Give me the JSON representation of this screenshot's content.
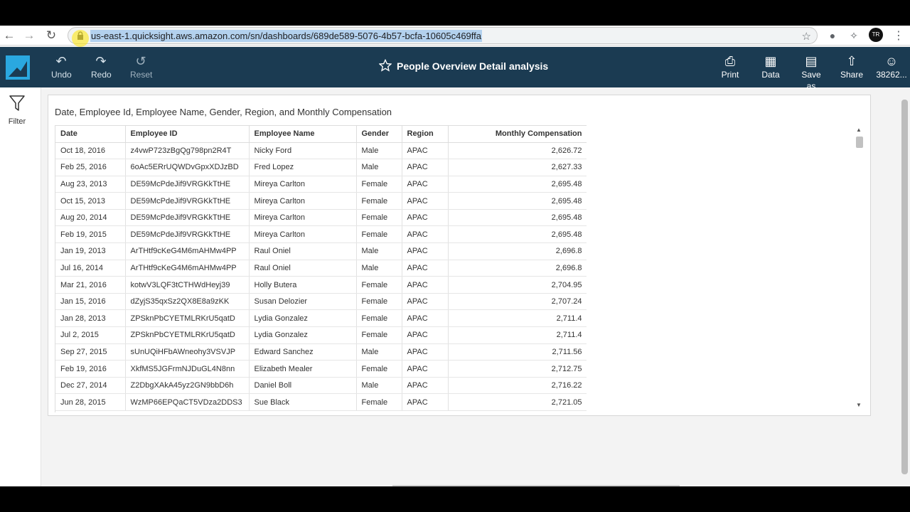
{
  "browser": {
    "url": "us-east-1.quicksight.aws.amazon.com/sn/dashboards/689de589-5076-4b57-bcfa-10605c469ffa",
    "profile_badge": "TR"
  },
  "toolbar": {
    "undo_label": "Undo",
    "redo_label": "Redo",
    "reset_label": "Reset",
    "title": "People Overview Detail analysis",
    "print_label": "Print",
    "data_label": "Data",
    "save_as_label": "Save as",
    "share_label": "Share",
    "account_label": "38262..."
  },
  "rail": {
    "filter_label": "Filter"
  },
  "visual": {
    "title": "Date, Employee Id, Employee Name, Gender, Region, and Monthly Compensation",
    "columns": [
      "Date",
      "Employee ID",
      "Employee Name",
      "Gender",
      "Region",
      "Monthly Compensation"
    ],
    "rows": [
      [
        "Oct 18, 2016",
        "z4vwP723zBgQg798pn2R4T",
        "Nicky Ford",
        "Male",
        "APAC",
        "2,626.72"
      ],
      [
        "Feb 25, 2016",
        "6oAc5ERrUQWDvGpxXDJzBD",
        "Fred Lopez",
        "Male",
        "APAC",
        "2,627.33"
      ],
      [
        "Aug 23, 2013",
        "DE59McPdeJif9VRGKkTtHE",
        "Mireya Carlton",
        "Female",
        "APAC",
        "2,695.48"
      ],
      [
        "Oct 15, 2013",
        "DE59McPdeJif9VRGKkTtHE",
        "Mireya Carlton",
        "Female",
        "APAC",
        "2,695.48"
      ],
      [
        "Aug 20, 2014",
        "DE59McPdeJif9VRGKkTtHE",
        "Mireya Carlton",
        "Female",
        "APAC",
        "2,695.48"
      ],
      [
        "Feb 19, 2015",
        "DE59McPdeJif9VRGKkTtHE",
        "Mireya Carlton",
        "Female",
        "APAC",
        "2,695.48"
      ],
      [
        "Jan 19, 2013",
        "ArTHtf9cKeG4M6mAHMw4PP",
        "Raul Oniel",
        "Male",
        "APAC",
        "2,696.8"
      ],
      [
        "Jul 16, 2014",
        "ArTHtf9cKeG4M6mAHMw4PP",
        "Raul Oniel",
        "Male",
        "APAC",
        "2,696.8"
      ],
      [
        "Mar 21, 2016",
        "kotwV3LQF3tCTHWdHeyj39",
        "Holly Butera",
        "Female",
        "APAC",
        "2,704.95"
      ],
      [
        "Jan 15, 2016",
        "dZyjS35qxSz2QX8E8a9zKK",
        "Susan Delozier",
        "Female",
        "APAC",
        "2,707.24"
      ],
      [
        "Jan 28, 2013",
        "ZPSknPbCYETMLRKrU5qatD",
        "Lydia Gonzalez",
        "Female",
        "APAC",
        "2,711.4"
      ],
      [
        "Jul 2, 2015",
        "ZPSknPbCYETMLRKrU5qatD",
        "Lydia Gonzalez",
        "Female",
        "APAC",
        "2,711.4"
      ],
      [
        "Sep 27, 2015",
        "sUnUQiHFbAWneohy3VSVJP",
        "Edward Sanchez",
        "Male",
        "APAC",
        "2,711.56"
      ],
      [
        "Feb 19, 2016",
        "XkfMS5JGFrmNJDuGL4N8nn",
        "Elizabeth Mealer",
        "Female",
        "APAC",
        "2,712.75"
      ],
      [
        "Dec 27, 2014",
        "Z2DbgXAkA45yz2GN9bbD6h",
        "Daniel Boll",
        "Male",
        "APAC",
        "2,716.22"
      ],
      [
        "Jun 28, 2015",
        "WzMP66EPQaCT5VDza2DDS3",
        "Sue Black",
        "Female",
        "APAC",
        "2,721.05"
      ]
    ]
  }
}
